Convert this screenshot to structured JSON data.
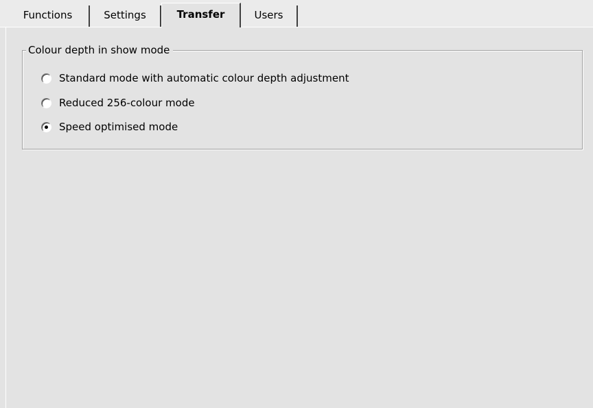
{
  "tabs": [
    {
      "label": "Functions",
      "active": false
    },
    {
      "label": "Settings",
      "active": false
    },
    {
      "label": "Transfer",
      "active": true
    },
    {
      "label": "Users",
      "active": false
    }
  ],
  "colour_depth_group": {
    "title": "Colour depth in show mode",
    "options": [
      {
        "label": "Standard mode with automatic colour depth adjustment",
        "selected": false
      },
      {
        "label": "Reduced 256-colour mode",
        "selected": false
      },
      {
        "label": "Speed optimised mode",
        "selected": true
      }
    ]
  },
  "colors": {
    "background": "#e3e3e3",
    "tab_strip": "#ebebeb",
    "highlight": "#ffffff",
    "shadow": "#404040"
  }
}
